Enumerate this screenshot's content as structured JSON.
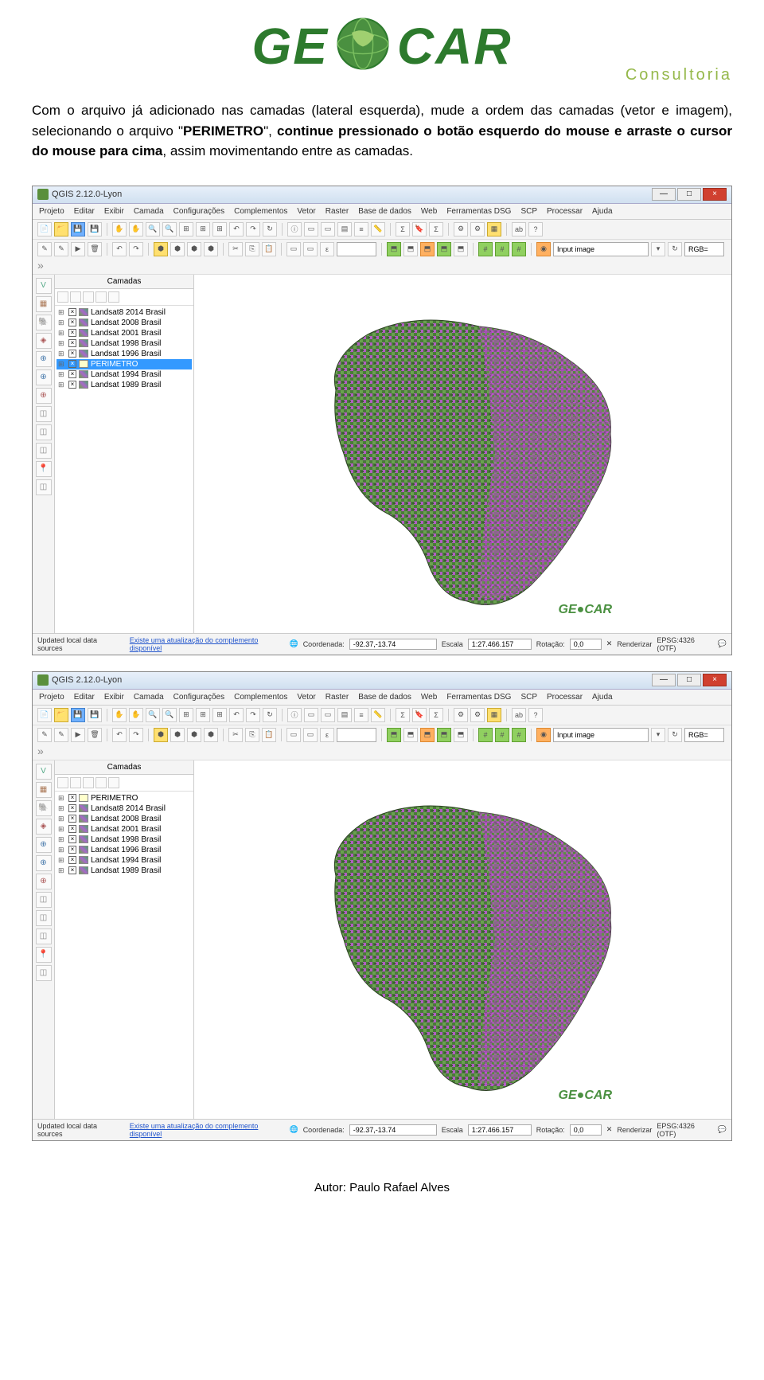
{
  "logo": {
    "ge": "GE",
    "car": "CAR",
    "subtitle": "Consultoria"
  },
  "intro": {
    "p1a": "Com o arquivo já adicionado nas camadas (lateral esquerda), mude a ordem das camadas (vetor e imagem), selecionando o arquivo \"",
    "p1b": "PERIMETRO",
    "p1c": "\", ",
    "p1d": "continue pressionado o botão esquerdo do mouse e arraste o cursor do mouse para cima",
    "p1e": ", assim movimentando entre as camadas."
  },
  "qgis": {
    "title": "QGIS 2.12.0-Lyon",
    "menus": [
      "Projeto",
      "Editar",
      "Exibir",
      "Camada",
      "Configurações",
      "Complementos",
      "Vetor",
      "Raster",
      "Base de dados",
      "Web",
      "Ferramentas DSG",
      "SCP",
      "Processar",
      "Ajuda"
    ],
    "layers_title": "Camadas",
    "input_label": "Input image",
    "rgb_label": "RGB=",
    "layers_a": [
      {
        "name": "Landsat8 2014 Brasil",
        "sel": false
      },
      {
        "name": "Landsat 2008 Brasil",
        "sel": false
      },
      {
        "name": "Landsat 2001 Brasil",
        "sel": false
      },
      {
        "name": "Landsat 1998 Brasil",
        "sel": false
      },
      {
        "name": "Landsat 1996 Brasil",
        "sel": false
      },
      {
        "name": "PERIMETRO",
        "sel": true
      },
      {
        "name": "Landsat 1994 Brasil",
        "sel": false
      },
      {
        "name": "Landsat 1989 Brasil",
        "sel": false
      }
    ],
    "layers_b": [
      {
        "name": "PERIMETRO",
        "sel": false
      },
      {
        "name": "Landsat8 2014 Brasil",
        "sel": false
      },
      {
        "name": "Landsat 2008 Brasil",
        "sel": false
      },
      {
        "name": "Landsat 2001 Brasil",
        "sel": false
      },
      {
        "name": "Landsat 1998 Brasil",
        "sel": false
      },
      {
        "name": "Landsat 1996 Brasil",
        "sel": false
      },
      {
        "name": "Landsat 1994 Brasil",
        "sel": false
      },
      {
        "name": "Landsat 1989 Brasil",
        "sel": false
      }
    ],
    "watermark": "GE●CAR",
    "status": {
      "updated": "Updated local data sources",
      "link": "Existe uma atualização do complemento disponível",
      "coord_label": "Coordenada:",
      "coord_value": "-92.37,-13.74",
      "scale_label": "Escala",
      "scale_value": "1:27.466.157",
      "rot_label": "Rotação:",
      "rot_value": "0,0",
      "render": "Renderizar",
      "epsg": "EPSG:4326 (OTF)"
    }
  },
  "footer": "Autor: Paulo Rafael Alves"
}
